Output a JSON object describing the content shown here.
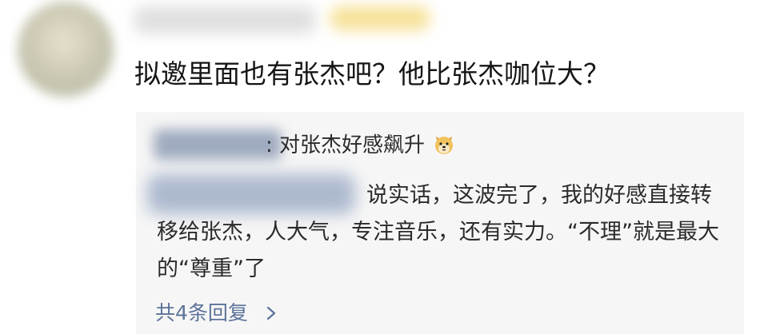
{
  "comment": {
    "text": "拟邀里面也有张杰吧？他比张杰咖位大？"
  },
  "reply": {
    "header_text": ": 对张杰好感飙升",
    "header_icon": "dog-face-emoji",
    "body_text": "说实话，这波完了，我的好感直接转移给张杰，人大气，专注音乐，还有实力。“不理”就是最大的“尊重”了"
  },
  "footer": {
    "expand_label": "共4条回复"
  },
  "colors": {
    "link": "#5c7399",
    "reply_bg": "#f6f6f6",
    "text": "#1b1b1b"
  }
}
